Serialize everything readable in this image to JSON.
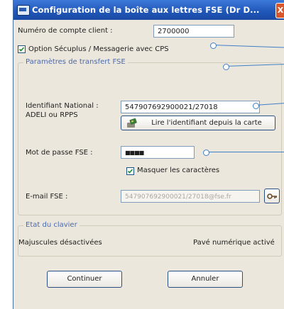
{
  "window": {
    "title": "Configuration de la boîte aux lettres FSE (Dr D...",
    "close_label": "X"
  },
  "account": {
    "label": "Numéro de compte client :",
    "value": "2700000"
  },
  "option_cps": {
    "label": "Option Sécuplus / Messagerie avec CPS",
    "checked": true
  },
  "transfer_group": {
    "title": "Paramètres de transfert FSE",
    "identifier_label_line1": "Identifiant National :",
    "identifier_label_line2": "ADELI ou RPPS",
    "identifier_value": "547907692900021/27018",
    "read_card_button": "Lire l'identifiant depuis la carte",
    "password_label": "Mot de passe FSE :",
    "password_mask": "■■■■",
    "mask_chars_label": "Masquer les caractères",
    "mask_chars_checked": true,
    "email_label": "E-mail FSE :",
    "email_value": "547907692900021/27018@fse.fr"
  },
  "keyboard_group": {
    "title": "Etat du clavier",
    "caps_status": "Majuscules désactivées",
    "numpad_status": "Pavé numérique activé"
  },
  "buttons": {
    "continue": "Continuer",
    "cancel": "Annuler"
  },
  "icons": [
    "app-window-icon",
    "close-icon",
    "check-icon",
    "card-reader-icon",
    "key-icon"
  ],
  "colors": {
    "titlebar": "#1f56b8",
    "dialog_bg": "#ece7dc",
    "group_title": "#4a69b0",
    "callout": "#3f7fc6"
  }
}
